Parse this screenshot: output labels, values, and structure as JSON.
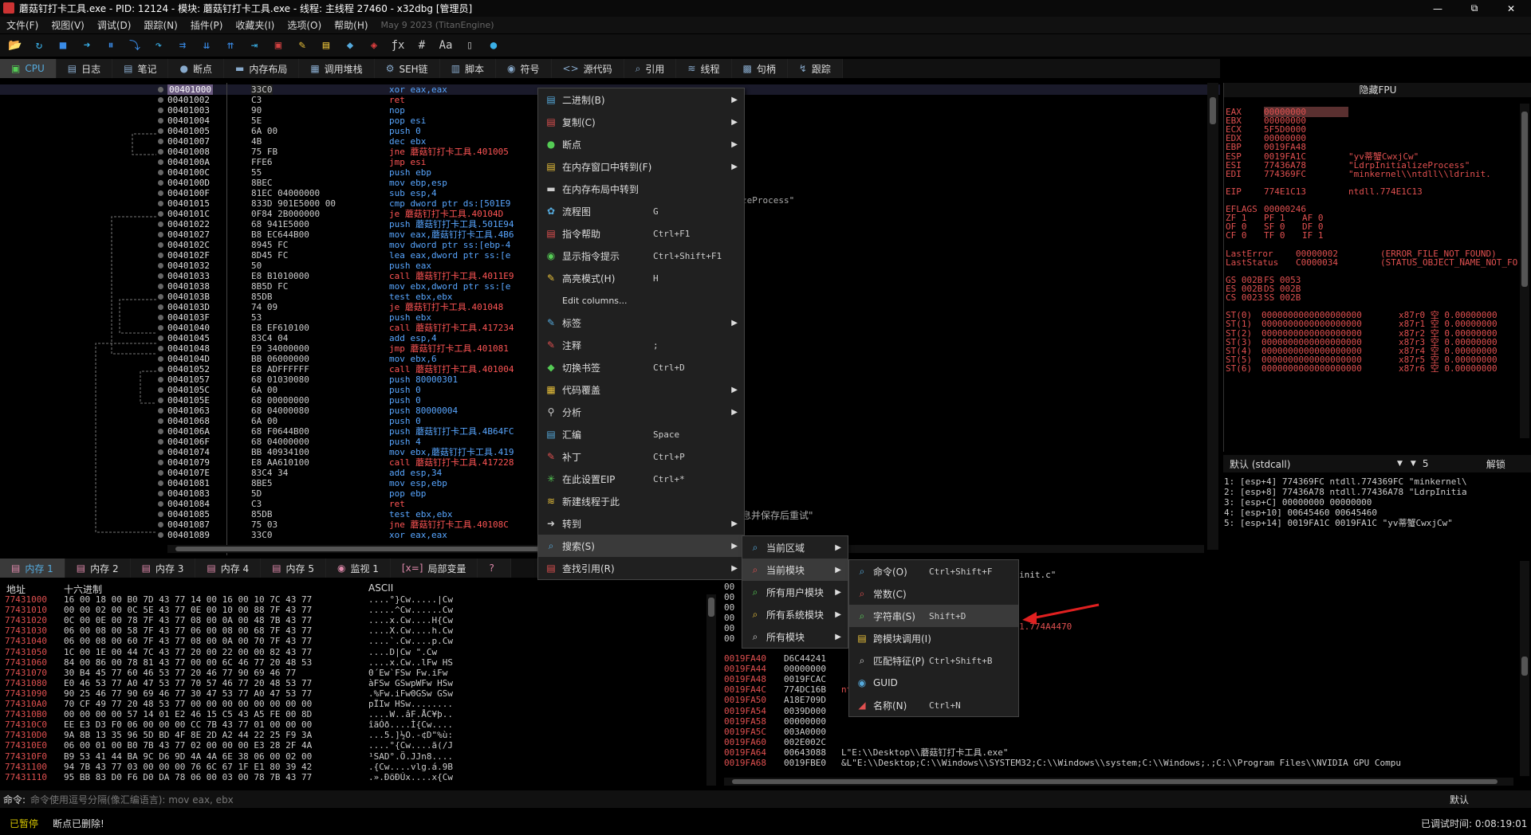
{
  "window": {
    "title": "蘑菇钉打卡工具.exe - PID: 12124 - 模块: 蘑菇钉打卡工具.exe - 线程: 主线程 27460 - x32dbg [管理员]",
    "min": "—",
    "max": "⧉",
    "close": "✕"
  },
  "menubar": {
    "items": [
      "文件(F)",
      "视图(V)",
      "调试(D)",
      "跟踪(N)",
      "插件(P)",
      "收藏夹(I)",
      "选项(O)",
      "帮助(H)"
    ],
    "build_date": "May 9 2023 (TitanEngine)"
  },
  "toolbar": {
    "icons": [
      "open-icon",
      "restart-icon",
      "stop-icon",
      "run-icon",
      "pause-icon",
      "step-into-icon",
      "step-over-icon",
      "trace-into-icon",
      "trace-over-icon",
      "run-until-return-icon",
      "run-to-user-icon",
      "patch-icon",
      "comment-icon",
      "label-icon",
      "bookmark-icon",
      "function-icon",
      "hash-icon",
      "font-icon",
      "script-icon",
      "calculator-icon",
      "help-icon"
    ],
    "glyphs": [
      "📂",
      "↻",
      "■",
      "➜",
      "⏸",
      "⤵",
      "↷",
      "⇉",
      "⇊",
      "⇈",
      "⇥",
      "▣",
      "✎",
      "▤",
      "◆",
      "◈",
      "ƒx",
      "#",
      "Aa",
      "▯",
      "●"
    ]
  },
  "tabs": [
    {
      "icon": "▣",
      "label": "CPU",
      "active": true
    },
    {
      "icon": "▤",
      "label": "日志"
    },
    {
      "icon": "▤",
      "label": "笔记"
    },
    {
      "icon": "●",
      "label": "断点"
    },
    {
      "icon": "▬",
      "label": "内存布局"
    },
    {
      "icon": "▦",
      "label": "调用堆栈"
    },
    {
      "icon": "⚙",
      "label": "SEH链"
    },
    {
      "icon": "▥",
      "label": "脚本"
    },
    {
      "icon": "◉",
      "label": "符号"
    },
    {
      "icon": "<>",
      "label": "源代码"
    },
    {
      "icon": "⌕",
      "label": "引用"
    },
    {
      "icon": "≋",
      "label": "线程"
    },
    {
      "icon": "▩",
      "label": "句柄"
    },
    {
      "icon": "↯",
      "label": "跟踪"
    }
  ],
  "disasm": {
    "rows": [
      {
        "addr": "00401000",
        "bytes": "33C0",
        "ins": "xor eax,eax",
        "red": false
      },
      {
        "addr": "00401002",
        "bytes": "C3",
        "ins": "ret",
        "red": true
      },
      {
        "addr": "00401003",
        "bytes": "90",
        "ins": "nop",
        "red": false
      },
      {
        "addr": "00401004",
        "bytes": "5E",
        "ins": "pop esi",
        "red": false
      },
      {
        "addr": "00401005",
        "bytes": "6A 00",
        "ins": "push 0",
        "red": false
      },
      {
        "addr": "00401007",
        "bytes": "4B",
        "ins": "dec ebx",
        "red": false
      },
      {
        "addr": "00401008",
        "bytes": "75 FB",
        "ins": "jne 蘑菇钉打卡工具.401005",
        "red": true
      },
      {
        "addr": "0040100A",
        "bytes": "FFE6",
        "ins": "jmp esi",
        "red": true
      },
      {
        "addr": "0040100C",
        "bytes": "55",
        "ins": "push ebp",
        "red": false
      },
      {
        "addr": "0040100D",
        "bytes": "8BEC",
        "ins": "mov ebp,esp",
        "red": false
      },
      {
        "addr": "0040100F",
        "bytes": "81EC 04000000",
        "ins": "sub esp,4",
        "red": false
      },
      {
        "addr": "00401015",
        "bytes": "833D 901E5000 00",
        "ins": "cmp dword ptr ds:[501E9",
        "red": false
      },
      {
        "addr": "0040101C",
        "bytes": "0F84 2B000000",
        "ins": "je 蘑菇钉打卡工具.40104D",
        "red": true
      },
      {
        "addr": "00401022",
        "bytes": "68 941E5000",
        "ins": "push 蘑菇钉打卡工具.501E94",
        "red": false
      },
      {
        "addr": "00401027",
        "bytes": "B8 EC644B00",
        "ins": "mov eax,蘑菇钉打卡工具.4B6",
        "red": false
      },
      {
        "addr": "0040102C",
        "bytes": "8945 FC",
        "ins": "mov dword ptr ss:[ebp-4",
        "red": false
      },
      {
        "addr": "0040102F",
        "bytes": "8D45 FC",
        "ins": "lea eax,dword ptr ss:[e",
        "red": false
      },
      {
        "addr": "00401032",
        "bytes": "50",
        "ins": "push eax",
        "red": false
      },
      {
        "addr": "00401033",
        "bytes": "E8 B1010000",
        "ins": "call 蘑菇钉打卡工具.4011E9",
        "red": true
      },
      {
        "addr": "00401038",
        "bytes": "8B5D FC",
        "ins": "mov ebx,dword ptr ss:[e",
        "red": false
      },
      {
        "addr": "0040103B",
        "bytes": "85DB",
        "ins": "test ebx,ebx",
        "red": false
      },
      {
        "addr": "0040103D",
        "bytes": "74 09",
        "ins": "je 蘑菇钉打卡工具.401048",
        "red": true
      },
      {
        "addr": "0040103F",
        "bytes": "53",
        "ins": "push ebx",
        "red": false
      },
      {
        "addr": "00401040",
        "bytes": "E8 EF610100",
        "ins": "call 蘑菇钉打卡工具.417234",
        "red": true
      },
      {
        "addr": "00401045",
        "bytes": "83C4 04",
        "ins": "add esp,4",
        "red": false
      },
      {
        "addr": "00401048",
        "bytes": "E9 34000000",
        "ins": "jmp 蘑菇钉打卡工具.401081",
        "red": true
      },
      {
        "addr": "0040104D",
        "bytes": "BB 06000000",
        "ins": "mov ebx,6",
        "red": false
      },
      {
        "addr": "00401052",
        "bytes": "E8 ADFFFFFF",
        "ins": "call 蘑菇钉打卡工具.401004",
        "red": true
      },
      {
        "addr": "00401057",
        "bytes": "68 01030080",
        "ins": "push 80000301",
        "red": false
      },
      {
        "addr": "0040105C",
        "bytes": "6A 00",
        "ins": "push 0",
        "red": false
      },
      {
        "addr": "0040105E",
        "bytes": "68 00000000",
        "ins": "push 0",
        "red": false
      },
      {
        "addr": "00401063",
        "bytes": "68 04000080",
        "ins": "push 80000004",
        "red": false
      },
      {
        "addr": "00401068",
        "bytes": "6A 00",
        "ins": "push 0",
        "red": false
      },
      {
        "addr": "0040106A",
        "bytes": "68 F0644B00",
        "ins": "push 蘑菇钉打卡工具.4B64FC",
        "red": false
      },
      {
        "addr": "0040106F",
        "bytes": "68 04000000",
        "ins": "push 4",
        "red": false
      },
      {
        "addr": "00401074",
        "bytes": "BB 40934100",
        "ins": "mov ebx,蘑菇钉打卡工具.419",
        "red": false
      },
      {
        "addr": "00401079",
        "bytes": "E8 AA610100",
        "ins": "call 蘑菇钉打卡工具.417228",
        "red": true
      },
      {
        "addr": "0040107E",
        "bytes": "83C4 34",
        "ins": "add esp,34",
        "red": false
      },
      {
        "addr": "00401081",
        "bytes": "8BE5",
        "ins": "mov esp,ebp",
        "red": false
      },
      {
        "addr": "00401083",
        "bytes": "5D",
        "ins": "pop ebp",
        "red": false
      },
      {
        "addr": "00401084",
        "bytes": "C3",
        "ins": "ret",
        "red": true
      },
      {
        "addr": "00401085",
        "bytes": "85DB",
        "ins": "test ebx,ebx",
        "red": false
      },
      {
        "addr": "00401087",
        "bytes": "75 03",
        "ins": "jne 蘑菇钉打卡工具.40108C",
        "red": true
      },
      {
        "addr": "00401089",
        "bytes": "33C0",
        "ins": "xor eax,eax",
        "red": false
      }
    ],
    "comment1": "zeProcess\"",
    "comment2": "息并保存后重试\""
  },
  "context_menu": {
    "items": [
      {
        "icon": "▤",
        "label": "二进制(B)",
        "shortcut": "",
        "sub": true
      },
      {
        "icon": "▤",
        "label": "复制(C)",
        "shortcut": "",
        "sub": true
      },
      {
        "icon": "●",
        "label": "断点",
        "shortcut": "",
        "sub": true
      },
      {
        "icon": "▤",
        "label": "在内存窗口中转到(F)",
        "shortcut": "",
        "sub": true
      },
      {
        "icon": "▬",
        "label": "在内存布局中转到",
        "shortcut": "",
        "sub": false
      },
      {
        "icon": "✿",
        "label": "流程图",
        "shortcut": "G",
        "sub": false
      },
      {
        "icon": "▤",
        "label": "指令帮助",
        "shortcut": "Ctrl+F1",
        "sub": false
      },
      {
        "icon": "◉",
        "label": "显示指令提示",
        "shortcut": "Ctrl+Shift+F1",
        "sub": false
      },
      {
        "icon": "✎",
        "label": "高亮模式(H)",
        "shortcut": "H",
        "sub": false
      },
      {
        "icon": "",
        "label": "Edit columns...",
        "shortcut": "",
        "sub": false
      },
      {
        "icon": "✎",
        "label": "标签",
        "shortcut": "",
        "sub": true
      },
      {
        "icon": "✎",
        "label": "注释",
        "shortcut": ";",
        "sub": false
      },
      {
        "icon": "◆",
        "label": "切换书签",
        "shortcut": "Ctrl+D",
        "sub": false
      },
      {
        "icon": "▦",
        "label": "代码覆盖",
        "shortcut": "",
        "sub": true
      },
      {
        "icon": "⚲",
        "label": "分析",
        "shortcut": "",
        "sub": true
      },
      {
        "icon": "▤",
        "label": "汇编",
        "shortcut": "Space",
        "sub": false
      },
      {
        "icon": "✎",
        "label": "补丁",
        "shortcut": "Ctrl+P",
        "sub": false
      },
      {
        "icon": "✳",
        "label": "在此设置EIP",
        "shortcut": "Ctrl+*",
        "sub": false
      },
      {
        "icon": "≋",
        "label": "新建线程于此",
        "shortcut": "",
        "sub": false
      },
      {
        "icon": "➜",
        "label": "转到",
        "shortcut": "",
        "sub": true
      },
      {
        "icon": "⌕",
        "label": "搜索(S)",
        "shortcut": "",
        "sub": true,
        "hl": true
      },
      {
        "icon": "▤",
        "label": "查找引用(R)",
        "shortcut": "",
        "sub": true
      }
    ]
  },
  "submenu_search": {
    "items": [
      {
        "icon": "⌕",
        "label": "当前区域",
        "sub": true
      },
      {
        "icon": "⌕",
        "label": "当前模块",
        "sub": true,
        "hl": true
      },
      {
        "icon": "⌕",
        "label": "所有用户模块",
        "sub": true
      },
      {
        "icon": "⌕",
        "label": "所有系统模块",
        "sub": true
      },
      {
        "icon": "⌕",
        "label": "所有模块",
        "sub": true
      }
    ]
  },
  "submenu_module": {
    "items": [
      {
        "icon": "⌕",
        "label": "命令(O)",
        "shortcut": "Ctrl+Shift+F"
      },
      {
        "icon": "⌕",
        "label": "常数(C)",
        "shortcut": ""
      },
      {
        "icon": "⌕",
        "label": "字符串(S)",
        "shortcut": "Shift+D",
        "hl": true
      },
      {
        "icon": "▤",
        "label": "跨模块调用(I)",
        "shortcut": ""
      },
      {
        "icon": "⌕",
        "label": "匹配特征(P)",
        "shortcut": "Ctrl+Shift+B"
      },
      {
        "icon": "◉",
        "label": "GUID",
        "shortcut": ""
      },
      {
        "icon": "◢",
        "label": "名称(N)",
        "shortcut": "Ctrl+N"
      }
    ]
  },
  "registers": {
    "header": "隐藏FPU",
    "lines": [
      {
        "k": "EAX",
        "v": "00000000",
        "c": "",
        "hl": true
      },
      {
        "k": "EBX",
        "v": "00000000",
        "c": ""
      },
      {
        "k": "ECX",
        "v": "5F5D0000",
        "c": ""
      },
      {
        "k": "EDX",
        "v": "00000000",
        "c": ""
      },
      {
        "k": "EBP",
        "v": "0019FA48",
        "c": ""
      },
      {
        "k": "ESP",
        "v": "0019FA1C",
        "c": "\"yv蒂蟹CwxjCw\""
      },
      {
        "k": "ESI",
        "v": "77436A78",
        "c": "\"LdrpInitializeProcess\""
      },
      {
        "k": "EDI",
        "v": "774369FC",
        "c": "\"minkernel\\\\ntdll\\\\ldrinit."
      },
      {
        "k": "",
        "v": "",
        "c": ""
      },
      {
        "k": "EIP",
        "v": "774E1C13",
        "c": "ntdll.774E1C13"
      },
      {
        "k": "",
        "v": "",
        "c": ""
      },
      {
        "k": "EFLAGS",
        "v": "00000246",
        "c": ""
      },
      {
        "k": "ZF 1",
        "v": "PF 1",
        "c": "AF 0"
      },
      {
        "k": "OF 0",
        "v": "SF 0",
        "c": "DF 0"
      },
      {
        "k": "CF 0",
        "v": "TF 0",
        "c": "IF 1"
      },
      {
        "k": "",
        "v": "",
        "c": ""
      },
      {
        "k": "LastError",
        "v": "00000002",
        "c": "(ERROR_FILE_NOT_FOUND)"
      },
      {
        "k": "LastStatus",
        "v": "C0000034",
        "c": "(STATUS_OBJECT_NAME_NOT_FO"
      },
      {
        "k": "",
        "v": "",
        "c": ""
      },
      {
        "k": "GS 002B",
        "v": "FS 0053",
        "c": ""
      },
      {
        "k": "ES 002B",
        "v": "DS 002B",
        "c": ""
      },
      {
        "k": "CS 0023",
        "v": "SS 002B",
        "c": ""
      },
      {
        "k": "",
        "v": "",
        "c": ""
      },
      {
        "k": "ST(0)",
        "v": "0000000000000000000",
        "c": "x87r0 空 0.00000000"
      },
      {
        "k": "ST(1)",
        "v": "0000000000000000000",
        "c": "x87r1 空 0.00000000"
      },
      {
        "k": "ST(2)",
        "v": "0000000000000000000",
        "c": "x87r2 空 0.00000000"
      },
      {
        "k": "ST(3)",
        "v": "0000000000000000000",
        "c": "x87r3 空 0.00000000"
      },
      {
        "k": "ST(4)",
        "v": "0000000000000000000",
        "c": "x87r4 空 0.00000000"
      },
      {
        "k": "ST(5)",
        "v": "0000000000000000000",
        "c": "x87r5 空 0.00000000"
      },
      {
        "k": "ST(6)",
        "v": "0000000000000000000",
        "c": "x87r6 空 0.00000000"
      }
    ]
  },
  "callstack": {
    "convention": "默认 (stdcall)",
    "count": "5",
    "unlock": "解锁",
    "rows": [
      "1: [esp+4] 774369FC ntdll.774369FC \"minkernel\\",
      "2: [esp+8] 77436A78 ntdll.77436A78 \"LdrpInitia",
      "3: [esp+C] 00000000 00000000",
      "4: [esp+10] 00645460 00645460",
      "5: [esp+14] 0019FA1C 0019FA1C \"yv蒂蟹CwxjCw\""
    ]
  },
  "bottom_tabs": [
    {
      "icon": "▤",
      "label": "内存 1",
      "active": true
    },
    {
      "icon": "▤",
      "label": "内存 2"
    },
    {
      "icon": "▤",
      "label": "内存 3"
    },
    {
      "icon": "▤",
      "label": "内存 4"
    },
    {
      "icon": "▤",
      "label": "内存 5"
    },
    {
      "icon": "◉",
      "label": "监视 1"
    },
    {
      "icon": "[x=]",
      "label": "局部变量"
    },
    {
      "icon": "?",
      "label": ""
    }
  ],
  "dump": {
    "col_addr": "地址",
    "col_hex": "十六进制",
    "col_ascii": "ASCII",
    "rows": [
      {
        "a": "77431000",
        "h": "16 00 18 00 B0 7D 43 77 14 00 16 00 10 7C 43 77",
        "s": "....°}Cw.....|Cw"
      },
      {
        "a": "77431010",
        "h": "00 00 02 00 0C 5E 43 77 0E 00 10 00 88 7F 43 77",
        "s": ".....^Cw......Cw"
      },
      {
        "a": "77431020",
        "h": "0C 00 0E 00 78 7F 43 77 08 00 0A 00 48 7B 43 77",
        "s": "....x.Cw....H{Cw"
      },
      {
        "a": "77431030",
        "h": "06 00 08 00 58 7F 43 77 06 00 08 00 68 7F 43 77",
        "s": "....X.Cw....h.Cw"
      },
      {
        "a": "77431040",
        "h": "06 00 08 00 60 7F 43 77 08 00 0A 00 70 7F 43 77",
        "s": "....`.Cw....p.Cw"
      },
      {
        "a": "77431050",
        "h": "1C 00 1E 00 44 7C 43 77 20 00 22 00 00 82 43 77",
        "s": "....D|Cw \".Cw"
      },
      {
        "a": "77431060",
        "h": "84 00 86 00 78 81 43 77 00 00 6C 46 77 20 48 53",
        "s": "....x.Cw..lFw HS"
      },
      {
        "a": "77431070",
        "h": "30 B4 45 77 60 46 53 77 20 46 77 90 69 46 77",
        "s": "0´Ew`FSw Fw.iFw"
      },
      {
        "a": "77431080",
        "h": "E0 46 53 77 A0 47 53 77 70 57 46 77 20 48 53 77",
        "s": "àFSw GSwpWFw HSw"
      },
      {
        "a": "77431090",
        "h": "90 25 46 77 90 69 46 77 30 47 53 77 A0 47 53 77",
        "s": ".%Fw.iFw0GSw GSw"
      },
      {
        "a": "774310A0",
        "h": "70 CF 49 77 20 48 53 77 00 00 00 00 00 00 00 00",
        "s": "pÏIw HSw........"
      },
      {
        "a": "774310B0",
        "h": "00 00 00 00 57 14 01 E2 46 15 C5 43 A5 FE 00 8D",
        "s": "....W..âF.ÅC¥þ.."
      },
      {
        "a": "774310C0",
        "h": "EE E3 D3 F0 06 00 00 00 CC 7B 43 77 01 00 00 00",
        "s": "îãÓð....Ì{Cw...."
      },
      {
        "a": "774310D0",
        "h": "9A 8B 13 35 96 5D BD 4F 8E 2D A2 44 22 25 F9 3A",
        "s": "...5.]½O.-¢D\"%ù:"
      },
      {
        "a": "774310E0",
        "h": "06 00 01 00 B0 7B 43 77 02 00 00 00 E3 28 2F 4A",
        "s": "....°{Cw....ã(/J"
      },
      {
        "a": "774310F0",
        "h": "B9 53 41 44 BA 9C D6 9D 4A 4A 6E 38 06 00 02 00",
        "s": "¹SAD°.Ö.JJn8...."
      },
      {
        "a": "77431100",
        "h": "94 7B 43 77 03 00 00 00 76 6C 67 1F E1 80 39 42",
        "s": ".{Cw....vlg.á.9B"
      },
      {
        "a": "77431110",
        "h": "95 BB 83 D0 F6 D0 DA 78 06 00 03 00 78 7B 43 77",
        "s": ".».ÐöÐÚx....x{Cw"
      }
    ]
  },
  "stack": {
    "rows": [
      {
        "a": "0019FA40",
        "v": "D6C44241",
        "c": ""
      },
      {
        "a": "0019FA44",
        "v": "00000000",
        "c": ""
      },
      {
        "a": "0019FA48",
        "v": "0019FCAC",
        "c": ""
      },
      {
        "a": "0019FA4C",
        "v": "774DC16B",
        "c": "ntdll.774E1BE7"
      },
      {
        "a": "0019FA50",
        "v": "A18E709D",
        "c": ""
      },
      {
        "a": "0019FA54",
        "v": "0039D000",
        "c": ""
      },
      {
        "a": "0019FA58",
        "v": "00000000",
        "c": ""
      },
      {
        "a": "0019FA5C",
        "v": "003A0000",
        "c": ""
      },
      {
        "a": "0019FA60",
        "v": "002E002C",
        "c": ""
      },
      {
        "a": "0019FA64",
        "v": "00643088",
        "c": "L\"E:\\\\Desktop\\\\蘑菇钉打卡工具.exe\""
      },
      {
        "a": "0019FA68",
        "v": "0019FBE0",
        "c": "&L\"E:\\\\Desktop;C:\\\\Windows\\\\SYSTEM32;C:\\\\Windows\\\\system;C:\\\\Windows;.;C:\\\\Program Files\\\\NVIDIA GPU Compu"
      }
    ],
    "upper_comments": [
      "init.c\"",
      "1.774A4470"
    ]
  },
  "cmdbar": {
    "label": "命令:",
    "placeholder": "命令使用逗号分隔(像汇编语言): mov eax, ebx",
    "default": "默认"
  },
  "status": {
    "state": "已暂停",
    "message": "断点已删除!",
    "time": "已调试时间: 0:08:19:01"
  }
}
